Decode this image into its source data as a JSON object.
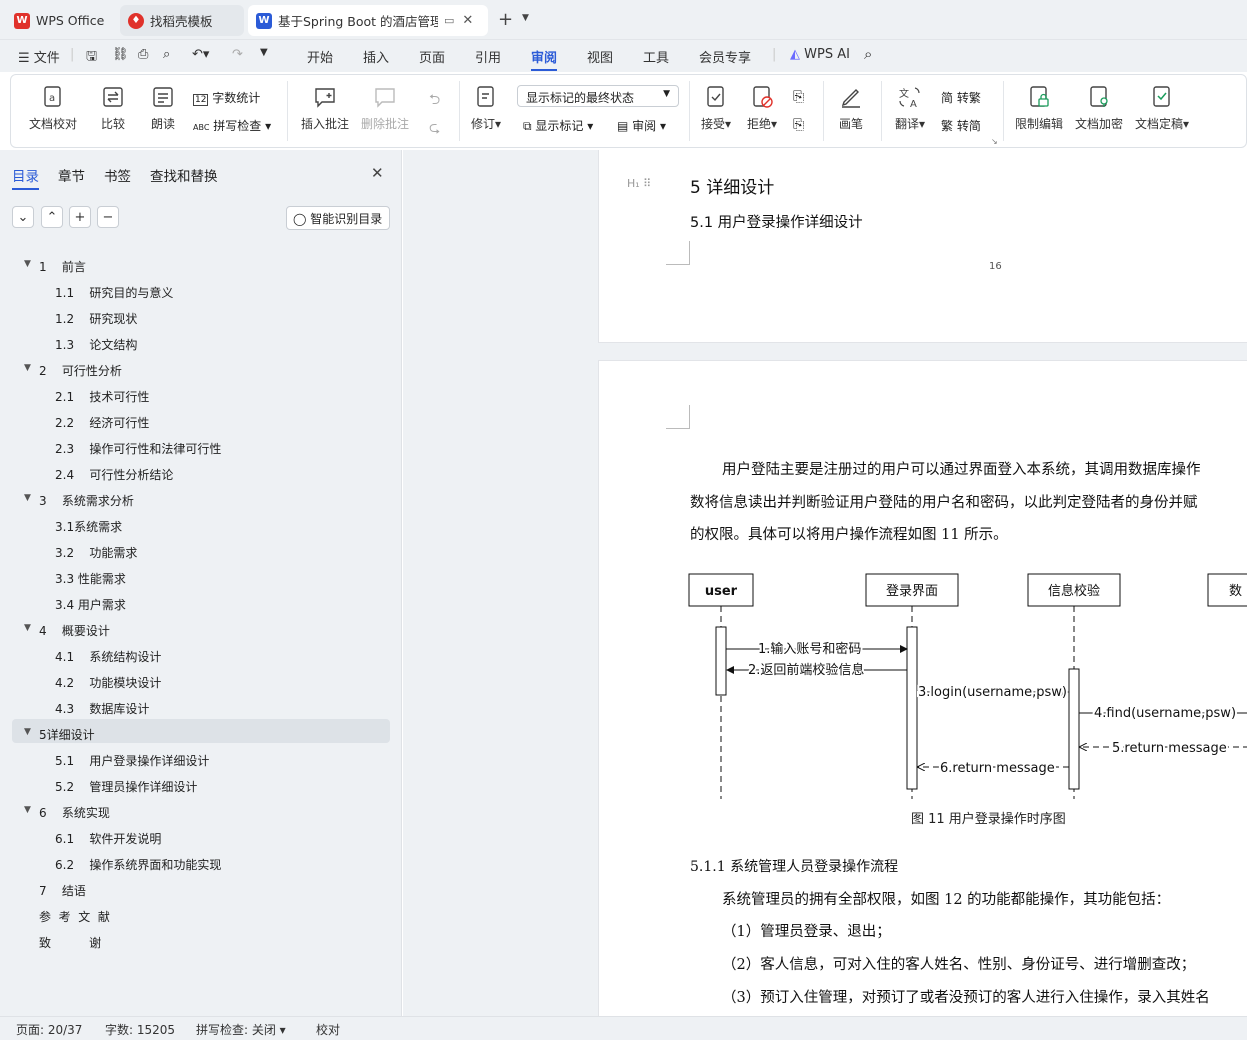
{
  "tabs": [
    {
      "label": "WPS Office",
      "icon": "wps-logo-icon"
    },
    {
      "label": "找稻壳模板",
      "icon": "docer-icon"
    },
    {
      "label": "基于Spring Boot 的酒店管理",
      "icon": "word-doc-icon"
    }
  ],
  "tab_new": "+",
  "menu": {
    "file": "文件",
    "items": [
      "开始",
      "插入",
      "页面",
      "引用",
      "审阅",
      "视图",
      "工具",
      "会员专享"
    ],
    "active": "审阅",
    "ai": "WPS AI"
  },
  "ribbon": {
    "proofread": "文档校对",
    "compare": "比较",
    "read_aloud": "朗读",
    "word_count": "字数统计",
    "spell_check": "拼写检查",
    "insert_comment": "插入批注",
    "delete_comment": "删除批注",
    "track": "修订",
    "markup_state": "显示标记的最终状态",
    "show_markup": "显示标记",
    "review": "审阅",
    "accept": "接受",
    "reject": "拒绝",
    "ink": "画笔",
    "translate": "翻译",
    "to_traditional": "转繁",
    "to_simplified": "转简",
    "restrict": "限制编辑",
    "encrypt": "文档加密",
    "finalize": "文档定稿"
  },
  "sidebar": {
    "tabs": [
      "目录",
      "章节",
      "书签",
      "查找和替换"
    ],
    "smart_toc": "智能识别目录",
    "toc": [
      {
        "t": "1    前言",
        "lvl": 1,
        "exp": true
      },
      {
        "t": "1.1    研究目的与意义",
        "lvl": 2
      },
      {
        "t": "1.2    研究现状",
        "lvl": 2
      },
      {
        "t": "1.3    论文结构",
        "lvl": 2
      },
      {
        "t": "2    可行性分析",
        "lvl": 1,
        "exp": true
      },
      {
        "t": "2.1    技术可行性",
        "lvl": 2
      },
      {
        "t": "2.2    经济可行性",
        "lvl": 2
      },
      {
        "t": "2.3    操作可行性和法律可行性",
        "lvl": 2
      },
      {
        "t": "2.4    可行性分析结论",
        "lvl": 2
      },
      {
        "t": "3    系统需求分析",
        "lvl": 1,
        "exp": true
      },
      {
        "t": "3.1系统需求",
        "lvl": 2
      },
      {
        "t": "3.2    功能需求",
        "lvl": 2
      },
      {
        "t": "3.3 性能需求",
        "lvl": 2
      },
      {
        "t": "3.4 用户需求",
        "lvl": 2
      },
      {
        "t": "4    概要设计",
        "lvl": 1,
        "exp": true
      },
      {
        "t": "4.1    系统结构设计",
        "lvl": 2
      },
      {
        "t": "4.2    功能模块设计",
        "lvl": 2
      },
      {
        "t": "4.3    数据库设计",
        "lvl": 2
      },
      {
        "t": "5详细设计",
        "lvl": 1,
        "exp": true,
        "sel": true
      },
      {
        "t": "5.1    用户登录操作详细设计",
        "lvl": 2
      },
      {
        "t": "5.2    管理员操作详细设计",
        "lvl": 2
      },
      {
        "t": "6    系统实现",
        "lvl": 1,
        "exp": true
      },
      {
        "t": "6.1    软件开发说明",
        "lvl": 2
      },
      {
        "t": "6.2    操作系统界面和功能实现",
        "lvl": 2
      },
      {
        "t": "7    结语",
        "lvl": 1
      },
      {
        "t": "参  考  文  献",
        "lvl": 1
      },
      {
        "t": "致          谢",
        "lvl": 1
      }
    ]
  },
  "doc": {
    "h1": "5  详细设计",
    "h2": "5.1      用户登录操作详细设计",
    "page_num": "16",
    "para1": [
      "用户登陆主要是注册过的用户可以通过界面登入本系统，其调用数据库操作",
      "数将信息读出并判断验证用户登陆的用户名和密码，以此判定登陆者的身份并赋",
      "的权限。具体可以将用户操作流程如图 11 所示。"
    ],
    "diagram": {
      "lifelines": [
        "user",
        "登录界面",
        "信息校验",
        "数"
      ],
      "msgs": [
        "1.输入账号和密码",
        "2.返回前端校验信息",
        "3.login(username,psw)",
        "4.find(username,psw)",
        "5.return message",
        "6.return message"
      ]
    },
    "caption": "图 11  用户登录操作时序图",
    "h3": "5.1.1  系统管理人员登录操作流程",
    "para2": "系统管理员的拥有全部权限，如图 12 的功能都能操作，其功能包括：",
    "items": [
      "（1）管理员登录、退出；",
      "（2）客人信息，可对入住的客人姓名、性别、身份证号、进行增删查改；",
      "（3）预订入住管理，对预订了或者没预订的客人进行入住操作，录入其姓名"
    ]
  },
  "status": {
    "page": "页面: 20/37",
    "words": "字数: 15205",
    "spell": "拼写检查: 关闭",
    "proof": "校对"
  },
  "colors": {
    "accent": "#2b5bd7",
    "wps_red": "#e0322b"
  }
}
